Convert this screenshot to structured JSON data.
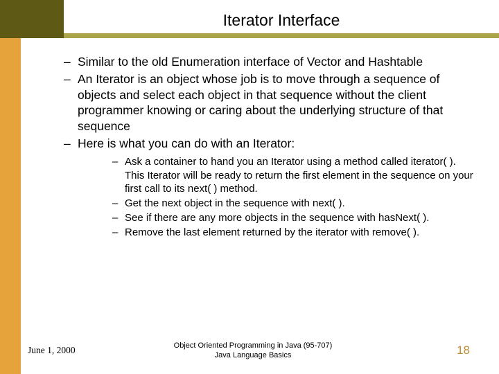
{
  "title": "Iterator Interface",
  "bullets_level1": [
    "Similar to the old Enumeration interface of Vector and Hashtable",
    "An Iterator is an object whose job is to move through a sequence of objects and select each object in that sequence without the client programmer knowing or caring about the underlying structure of that sequence",
    "Here is what you can do with an Iterator:"
  ],
  "bullets_level2": [
    "Ask a container to hand you an Iterator using a method called iterator( ). This Iterator will be ready to return the first element in the sequence on your first call to its next( ) method.",
    "Get the next object in the sequence with next( ).",
    "See if there are any more objects in the sequence with hasNext( ).",
    "Remove the last element returned by the iterator with remove( )."
  ],
  "footer": {
    "date": "June 1, 2000",
    "center_line1": "Object Oriented Programming in Java  (95-707)",
    "center_line2": "Java Language Basics",
    "page": "18"
  }
}
